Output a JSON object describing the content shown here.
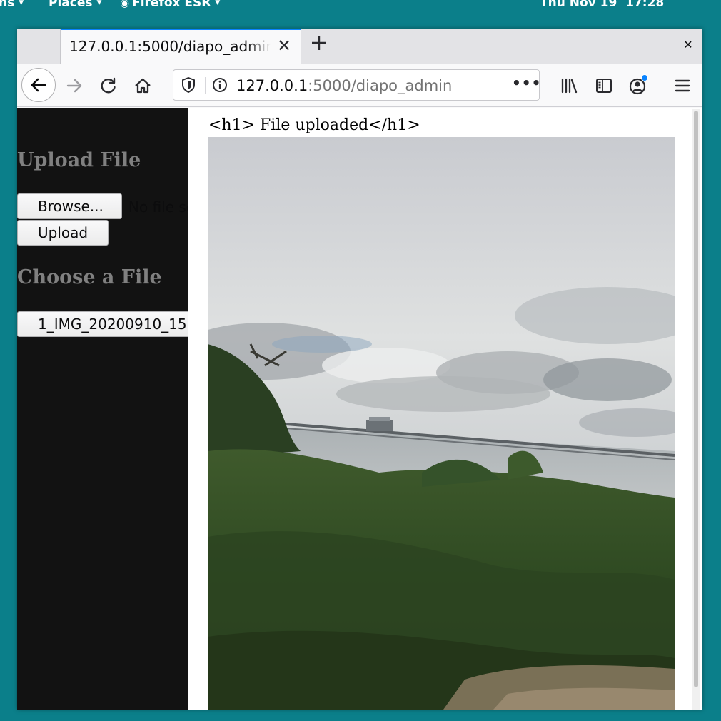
{
  "topbar": {
    "activities_partial": "ns",
    "places": "Places",
    "app_menu": "Firefox ESR",
    "clock": "Thu Nov 19  17:28"
  },
  "browser": {
    "tab_title": "127.0.0.1:5000/diapo_admin",
    "url_host": "127.0.0.1",
    "url_path": ":5000/diapo_admin",
    "accent_color": "#0a84ff"
  },
  "sidebar": {
    "upload_heading": "Upload File",
    "browse_label": "Browse...",
    "no_file_text": "No file selected.",
    "upload_label": "Upload",
    "choose_heading": "Choose a File",
    "file_option": "1_IMG_20200910_15"
  },
  "main": {
    "title": "<h1> File uploaded</h1>"
  }
}
